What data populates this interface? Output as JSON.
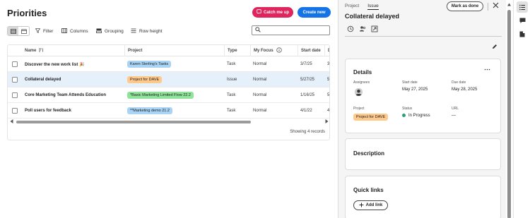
{
  "header": {
    "title": "Priorities",
    "catch_up_label": "Catch me up",
    "create_label": "Create new"
  },
  "toolbar": {
    "filter_label": "Filter",
    "columns_label": "Columns",
    "grouping_label": "Grouping",
    "row_height_label": "Row height",
    "search_placeholder": ""
  },
  "table": {
    "columns": [
      "Name",
      "Project",
      "Type",
      "My Focus",
      "Start date",
      "D"
    ],
    "rows": [
      {
        "name": "Discover the new work list 🎉",
        "project": "Karen Sterling's Tasks",
        "project_color": "blue",
        "type": "Task",
        "focus": "Normal",
        "start": "3/7/25",
        "due": "3/"
      },
      {
        "name": "Collateral delayed",
        "project": "Project for DAVE",
        "project_color": "orange",
        "type": "Issue",
        "focus": "Normal",
        "start": "5/27/25",
        "due": "5/"
      },
      {
        "name": "Core Marketing Team Attends Education",
        "project": "*Basic Marketing Limited Flow 22.2",
        "project_color": "green",
        "type": "Task",
        "focus": "Normal",
        "start": "1/16/25",
        "due": "5/"
      },
      {
        "name": "Poll users for feedback",
        "project": "**Marketing demo 21.2",
        "project_color": "blue",
        "type": "Task",
        "focus": "Normal",
        "start": "4/1/22",
        "due": "4/"
      }
    ],
    "selected_row": 1,
    "footer": "Showing 4 records"
  },
  "detail": {
    "tabs": [
      "Project",
      "Issue"
    ],
    "active_tab": "Issue",
    "mark_done_label": "Mark as done",
    "title": "Collateral delayed",
    "details": {
      "heading": "Details",
      "assignees_label": "Assignees",
      "start_label": "Start date",
      "start_value": "May 27, 2025",
      "due_label": "Due date",
      "due_value": "May 28, 2025",
      "project_label": "Project",
      "project_value": "Project for DAVE",
      "status_label": "Status",
      "status_value": "In Progress",
      "url_label": "URL",
      "url_value": "—"
    },
    "description_heading": "Description",
    "quick_links_heading": "Quick links",
    "add_link_label": "Add link"
  },
  "colors": {
    "catch_up": "#e0245e",
    "create": "#1473e6",
    "tag_blue": "#a9d4f5",
    "tag_orange": "#ffc98c",
    "tag_green": "#8fe39a",
    "status_green": "#2d9d78",
    "selected_row": "#e6f0fb"
  }
}
